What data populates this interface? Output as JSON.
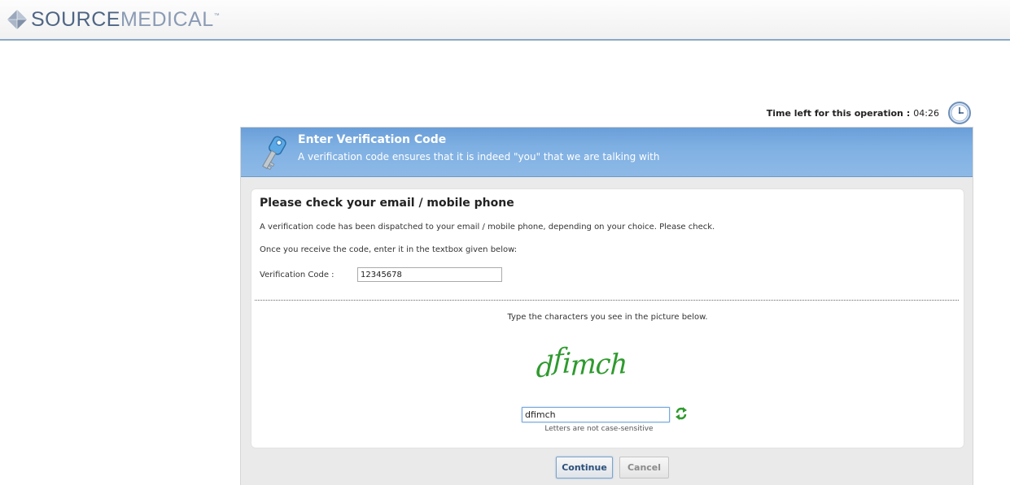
{
  "header": {
    "logo_primary": "SOURCE",
    "logo_secondary": "MEDICAL",
    "logo_tm": "™"
  },
  "timer": {
    "label": "Time left for this operation",
    "separator": ":",
    "value": "04:26"
  },
  "panel": {
    "title": "Enter Verification Code",
    "subtitle": "A verification code ensures that it is indeed \"you\" that we are talking with",
    "section_title": "Please check your email / mobile phone",
    "paragraph1": "A verification code has been dispatched to your email / mobile phone, depending on your choice. Please check.",
    "paragraph2": "Once you receive the code, enter it in the textbox given below:",
    "verification_label": "Verification Code :",
    "verification_value": "12345678",
    "captcha_instruction": "Type the characters you see in the picture below.",
    "captcha_text": "dfimch",
    "captcha_value": "dfimch",
    "captcha_hint": "Letters are not case-sensitive"
  },
  "buttons": {
    "continue_label": "Continue",
    "cancel_label": "Cancel"
  },
  "colors": {
    "header_blue": "#7fb0e3",
    "captcha_green": "#2e9a2e",
    "logo_blue": "#5a6f8e"
  },
  "icons": {
    "logo": "diamond-logo-icon",
    "timer": "clock-icon",
    "header": "key-icon",
    "refresh": "refresh-icon"
  }
}
